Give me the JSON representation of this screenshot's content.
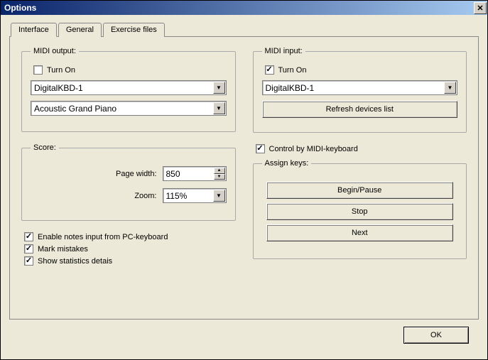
{
  "window": {
    "title": "Options"
  },
  "tabs": [
    "Interface",
    "General",
    "Exercise files"
  ],
  "midi_output": {
    "legend": "MIDI output:",
    "turn_on_label": "Turn On",
    "turn_on_checked": false,
    "device": "DigitalKBD-1",
    "instrument": "Acoustic Grand Piano"
  },
  "score": {
    "legend": "Score:",
    "page_width_label": "Page width:",
    "page_width": "850",
    "zoom_label": "Zoom:",
    "zoom": "115%"
  },
  "options": {
    "enable_pc_label": "Enable notes input from PC-keyboard",
    "enable_pc_checked": true,
    "mark_label": "Mark mistakes",
    "mark_checked": true,
    "stats_label": "Show statistics detais",
    "stats_checked": true
  },
  "midi_input": {
    "legend": "MIDI input:",
    "turn_on_label": "Turn On",
    "turn_on_checked": true,
    "device": "DigitalKBD-1",
    "refresh_label": "Refresh devices list"
  },
  "control": {
    "label": "Control by MIDI-keyboard",
    "checked": true
  },
  "assign": {
    "legend": "Assign keys:",
    "begin_label": "Begin/Pause",
    "stop_label": "Stop",
    "next_label": "Next"
  },
  "footer": {
    "ok_label": "OK"
  }
}
